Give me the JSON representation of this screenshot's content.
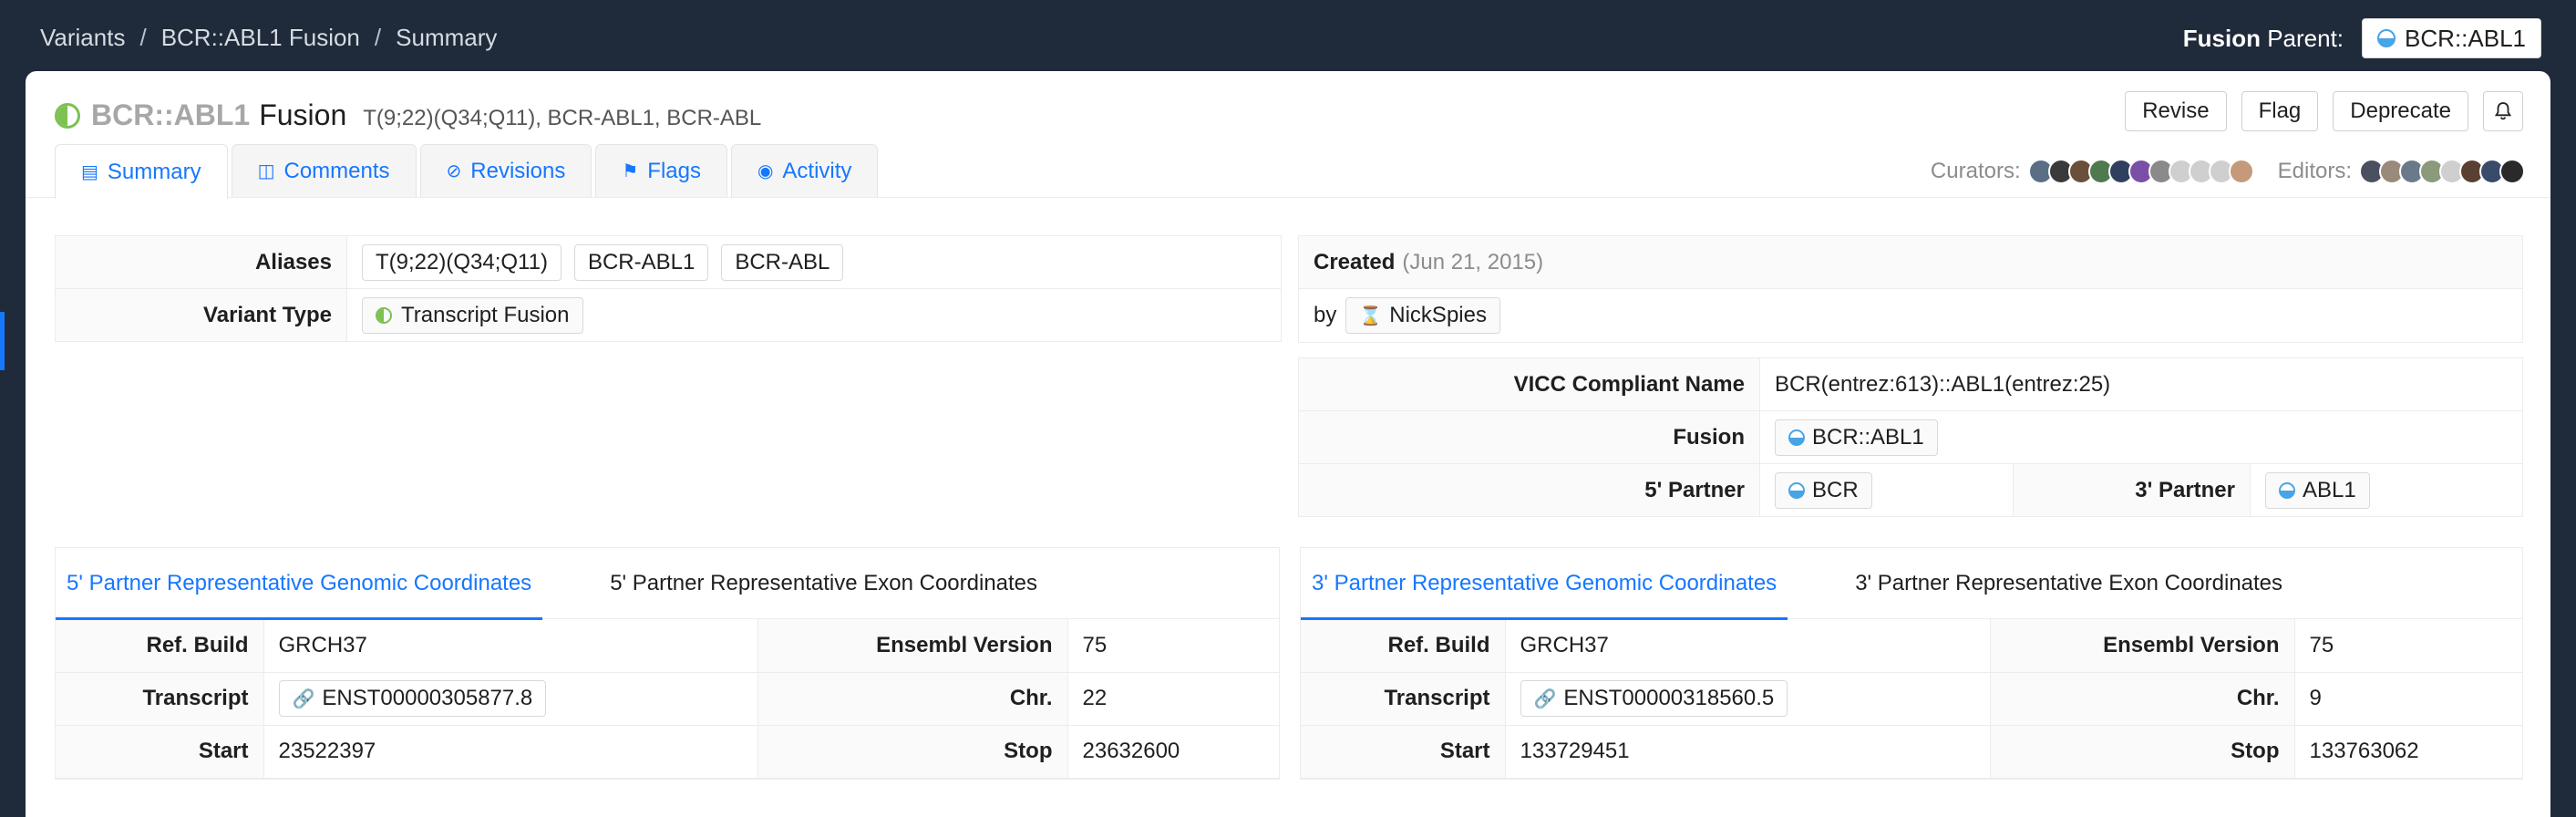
{
  "breadcrumb": [
    "Variants",
    "BCR::ABL1 Fusion",
    "Summary"
  ],
  "fusion_parent": {
    "label_bold": "Fusion",
    "label_rest": " Parent:",
    "value": "BCR::ABL1"
  },
  "title": {
    "gene": "BCR::ABL1",
    "type": "Fusion",
    "aliases_inline": "T(9;22)(Q34;Q11),  BCR-ABL1,  BCR-ABL"
  },
  "actions": {
    "revise": "Revise",
    "flag": "Flag",
    "deprecate": "Deprecate"
  },
  "tabs": [
    {
      "label": "Summary",
      "icon": "summary-icon"
    },
    {
      "label": "Comments",
      "icon": "comment-icon"
    },
    {
      "label": "Revisions",
      "icon": "revision-icon"
    },
    {
      "label": "Flags",
      "icon": "flag-icon"
    },
    {
      "label": "Activity",
      "icon": "activity-icon"
    }
  ],
  "people": {
    "curators_label": "Curators:",
    "editors_label": "Editors:"
  },
  "colors": {
    "accent": "#1677ff",
    "topbar": "#1f2a3a",
    "fusion_blue": "#47a4e6",
    "status_green": "#7cc151"
  },
  "details": {
    "aliases_label": "Aliases",
    "aliases": [
      "T(9;22)(Q34;Q11)",
      "BCR-ABL1",
      "BCR-ABL"
    ],
    "variant_type_label": "Variant Type",
    "variant_type": "Transcript Fusion"
  },
  "created": {
    "label": "Created",
    "date": "(Jun 21, 2015)",
    "by_label": "by",
    "user": "NickSpies"
  },
  "fusion_info": {
    "vicc_label": "VICC Compliant Name",
    "vicc_value": "BCR(entrez:613)::ABL1(entrez:25)",
    "fusion_label": "Fusion",
    "fusion_value": "BCR::ABL1",
    "five_label": "5' Partner",
    "five_value": "BCR",
    "three_label": "3' Partner",
    "three_value": "ABL1"
  },
  "five_prime": {
    "tab_genomic": "5' Partner Representative Genomic Coordinates",
    "tab_exon": "5' Partner Representative Exon Coordinates",
    "ref_build_label": "Ref. Build",
    "ref_build": "GRCH37",
    "ensembl_label": "Ensembl Version",
    "ensembl": "75",
    "transcript_label": "Transcript",
    "transcript": "ENST00000305877.8",
    "chr_label": "Chr.",
    "chr": "22",
    "start_label": "Start",
    "start": "23522397",
    "stop_label": "Stop",
    "stop": "23632600"
  },
  "three_prime": {
    "tab_genomic": "3' Partner Representative Genomic Coordinates",
    "tab_exon": "3' Partner Representative Exon Coordinates",
    "ref_build_label": "Ref. Build",
    "ref_build": "GRCH37",
    "ensembl_label": "Ensembl Version",
    "ensembl": "75",
    "transcript_label": "Transcript",
    "transcript": "ENST00000318560.5",
    "chr_label": "Chr.",
    "chr": "9",
    "start_label": "Start",
    "start": "133729451",
    "stop_label": "Stop",
    "stop": "133763062"
  }
}
